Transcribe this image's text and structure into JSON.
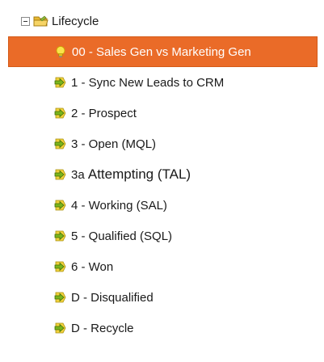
{
  "tree": {
    "folder": {
      "label": "Lifecycle",
      "expanded": true,
      "icon": "folder-icon"
    },
    "items": [
      {
        "label": "00 - Sales Gen vs Marketing Gen",
        "icon": "lightbulb-icon",
        "selected": true
      },
      {
        "label": "1 - Sync New Leads to CRM",
        "icon": "smart-campaign-icon"
      },
      {
        "label": "2 - Prospect",
        "icon": "smart-campaign-icon"
      },
      {
        "label": "3 - Open (MQL)",
        "icon": "smart-campaign-icon"
      },
      {
        "label_prefix": "3a",
        "label_main": "Attempting (TAL)",
        "icon": "smart-campaign-icon"
      },
      {
        "label": "4 - Working (SAL)",
        "icon": "smart-campaign-icon"
      },
      {
        "label": "5 - Qualified (SQL)",
        "icon": "smart-campaign-icon"
      },
      {
        "label": "6 - Won",
        "icon": "smart-campaign-icon"
      },
      {
        "label": "D - Disqualified",
        "icon": "smart-campaign-icon"
      },
      {
        "label": "D - Recycle",
        "icon": "smart-campaign-icon"
      }
    ]
  },
  "colors": {
    "selected_bg": "#ea6b28",
    "campaign_green": "#7ab51d",
    "campaign_yellow": "#f2d23c"
  }
}
